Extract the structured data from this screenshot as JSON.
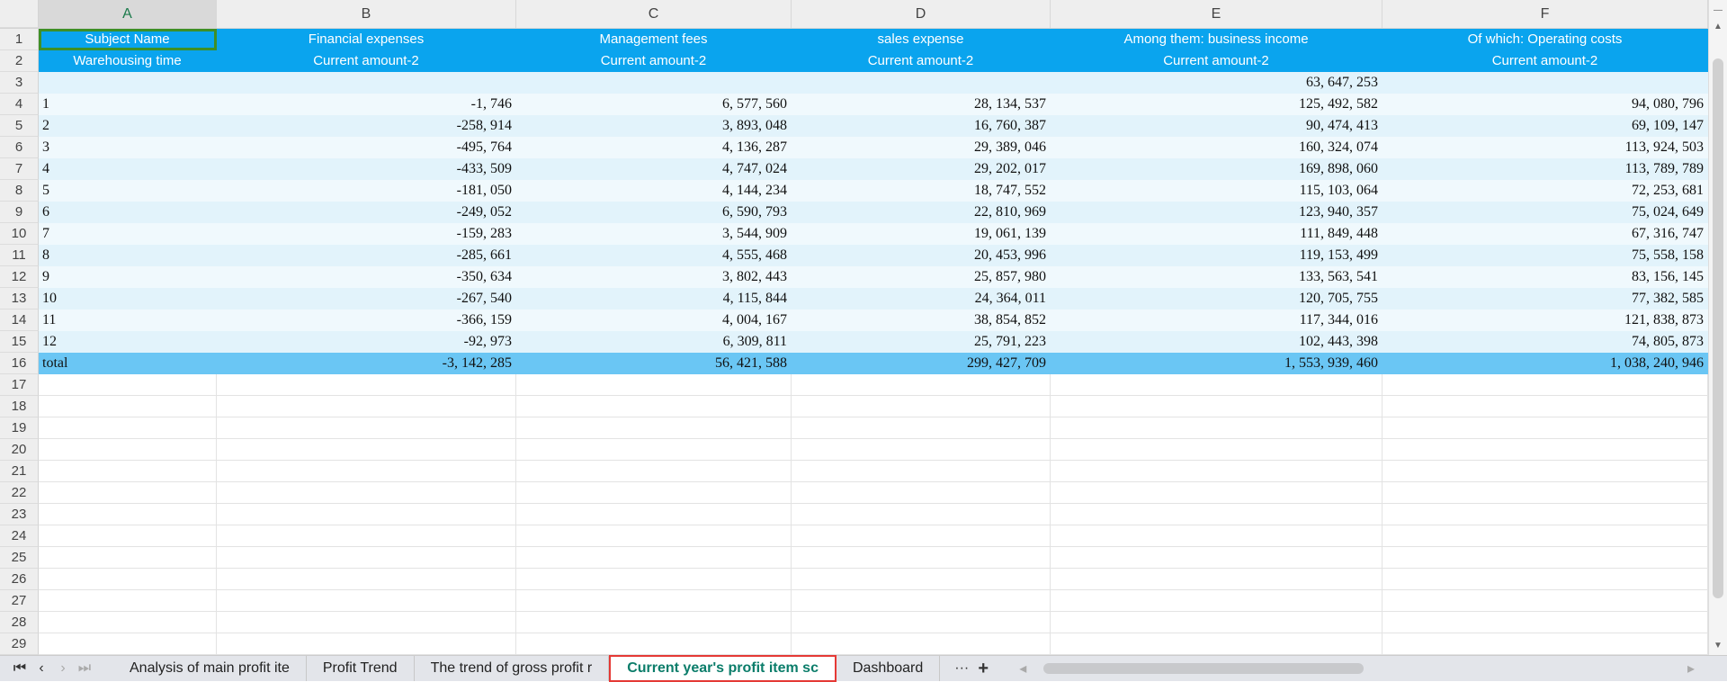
{
  "columns": [
    "A",
    "B",
    "C",
    "D",
    "E",
    "F"
  ],
  "header_row1": [
    "Subject Name",
    "Financial expenses",
    "Management fees",
    "sales expense",
    "Among them: business income",
    "Of which: Operating costs"
  ],
  "header_row2": [
    "Warehousing time",
    "Current amount-2",
    "Current amount-2",
    "Current amount-2",
    "Current amount-2",
    "Current amount-2"
  ],
  "row3": [
    "",
    "",
    "",
    "",
    "63, 647, 253",
    ""
  ],
  "data_rows": [
    [
      "1",
      "-1, 746",
      "6, 577, 560",
      "28, 134, 537",
      "125, 492, 582",
      "94, 080, 796"
    ],
    [
      "2",
      "-258, 914",
      "3, 893, 048",
      "16, 760, 387",
      "90, 474, 413",
      "69, 109, 147"
    ],
    [
      "3",
      "-495, 764",
      "4, 136, 287",
      "29, 389, 046",
      "160, 324, 074",
      "113, 924, 503"
    ],
    [
      "4",
      "-433, 509",
      "4, 747, 024",
      "29, 202, 017",
      "169, 898, 060",
      "113, 789, 789"
    ],
    [
      "5",
      "-181, 050",
      "4, 144, 234",
      "18, 747, 552",
      "115, 103, 064",
      "72, 253, 681"
    ],
    [
      "6",
      "-249, 052",
      "6, 590, 793",
      "22, 810, 969",
      "123, 940, 357",
      "75, 024, 649"
    ],
    [
      "7",
      "-159, 283",
      "3, 544, 909",
      "19, 061, 139",
      "111, 849, 448",
      "67, 316, 747"
    ],
    [
      "8",
      "-285, 661",
      "4, 555, 468",
      "20, 453, 996",
      "119, 153, 499",
      "75, 558, 158"
    ],
    [
      "9",
      "-350, 634",
      "3, 802, 443",
      "25, 857, 980",
      "133, 563, 541",
      "83, 156, 145"
    ],
    [
      "10",
      "-267, 540",
      "4, 115, 844",
      "24, 364, 011",
      "120, 705, 755",
      "77, 382, 585"
    ],
    [
      "11",
      "-366, 159",
      "4, 004, 167",
      "38, 854, 852",
      "117, 344, 016",
      "121, 838, 873"
    ],
    [
      "12",
      "-92, 973",
      "6, 309, 811",
      "25, 791, 223",
      "102, 443, 398",
      "74, 805, 873"
    ]
  ],
  "total_row": [
    "total",
    "-3, 142, 285",
    "56, 421, 588",
    "299, 427, 709",
    "1, 553, 939, 460",
    "1, 038, 240, 946"
  ],
  "row_count": 29,
  "tabs": [
    "Analysis of main profit ite",
    "Profit Trend",
    "The trend of gross profit r",
    "Current year's profit item sc",
    "Dashboard"
  ],
  "active_tab": 3,
  "tab_more": "···",
  "tab_add": "+"
}
